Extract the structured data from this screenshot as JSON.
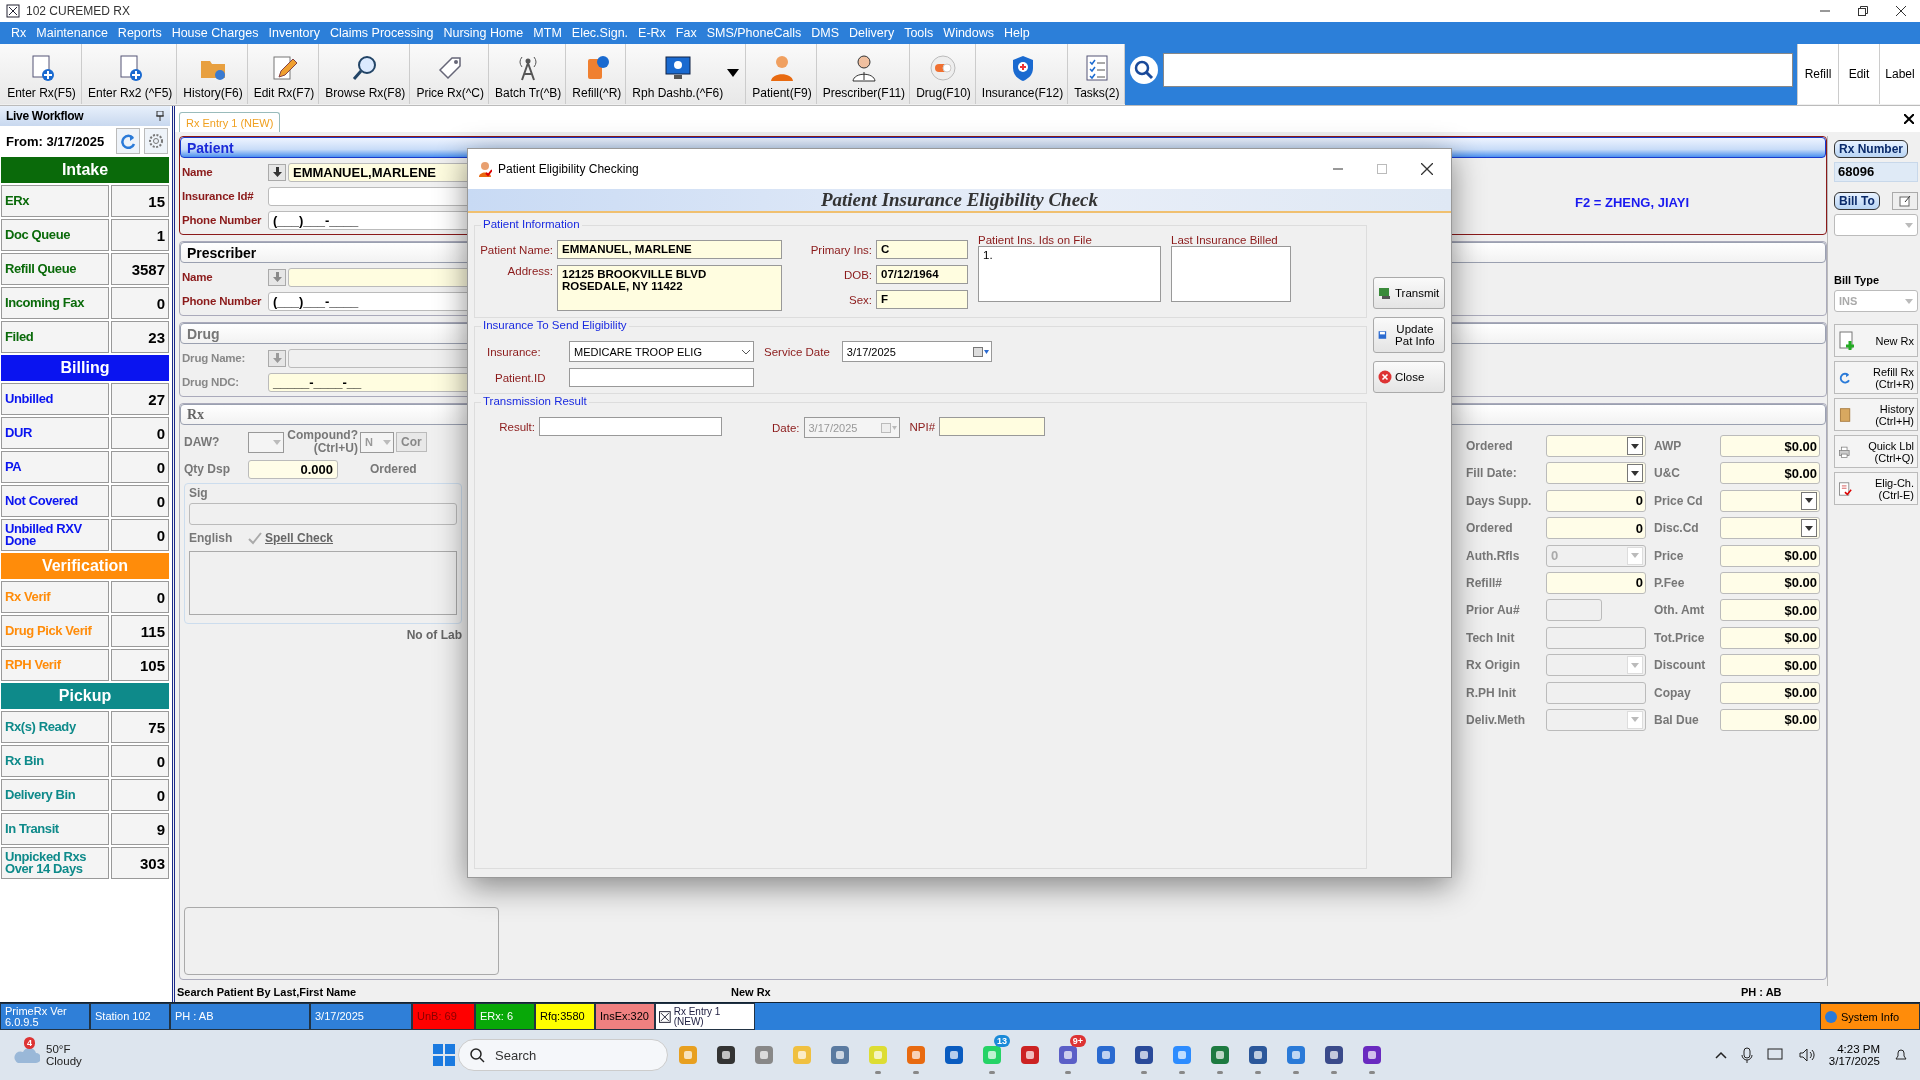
{
  "window": {
    "title": "102 CUREMED RX"
  },
  "menu": [
    "Rx",
    "Maintenance",
    "Reports",
    "House Charges",
    "Inventory",
    "Claims Processing",
    "Nursing Home",
    "MTM",
    "Elec.Sign.",
    "E-Rx",
    "Fax",
    "SMS/PhoneCalls",
    "DMS",
    "Delivery",
    "Tools",
    "Windows",
    "Help"
  ],
  "toolbar": [
    {
      "label": "Enter Rx(F5)",
      "has_menu": false
    },
    {
      "label": "Enter Rx2 (^F5)",
      "has_menu": false
    },
    {
      "label": "History(F6)",
      "has_menu": false
    },
    {
      "label": "Edit Rx(F7)",
      "has_menu": false
    },
    {
      "label": "Browse Rx(F8)",
      "has_menu": false
    },
    {
      "label": "Price Rx(^C)",
      "has_menu": false
    },
    {
      "label": "Batch Tr(^B)",
      "has_menu": false
    },
    {
      "label": "Refill(^R)",
      "has_menu": false
    },
    {
      "label": "Rph Dashb.(^F6)",
      "has_menu": true
    },
    {
      "label": "Patient(F9)",
      "has_menu": false
    },
    {
      "label": "Prescriber(F11)",
      "has_menu": false
    },
    {
      "label": "Drug(F10)",
      "has_menu": false
    },
    {
      "label": "Insurance(F12)",
      "has_menu": false
    },
    {
      "label": "Tasks(2)",
      "has_menu": false
    }
  ],
  "toolbar_right": [
    "Refill",
    "Edit",
    "Label"
  ],
  "sidebar": {
    "title": "Live Workflow",
    "from": "From: 3/17/2025",
    "groups": [
      {
        "title": "Intake",
        "color": "#0a6a0a",
        "items": [
          {
            "label": "ERx",
            "count": "15"
          },
          {
            "label": "Doc Queue",
            "count": "1"
          },
          {
            "label": "Refill Queue",
            "count": "3587"
          },
          {
            "label": "Incoming Fax",
            "count": "0"
          },
          {
            "label": "Filed",
            "count": "23"
          }
        ]
      },
      {
        "title": "Billing",
        "color": "#0a14f0",
        "items": [
          {
            "label": "Unbilled",
            "count": "27"
          },
          {
            "label": "DUR",
            "count": "0"
          },
          {
            "label": "PA",
            "count": "0"
          },
          {
            "label": "Not Covered",
            "count": "0"
          },
          {
            "label": "Unbilled RXV Done",
            "count": "0"
          }
        ]
      },
      {
        "title": "Verification",
        "color": "#ff8c0a",
        "items": [
          {
            "label": "Rx Verif",
            "count": "0"
          },
          {
            "label": "Drug Pick Verif",
            "count": "115"
          },
          {
            "label": "RPH Verif",
            "count": "105"
          }
        ]
      },
      {
        "title": "Pickup",
        "color": "#0e8a8a",
        "items": [
          {
            "label": "Rx(s) Ready",
            "count": "75"
          },
          {
            "label": "Rx Bin",
            "count": "0"
          },
          {
            "label": "Delivery Bin",
            "count": "0"
          },
          {
            "label": "In Transit",
            "count": "9"
          },
          {
            "label": "Unpicked Rxs Over 14 Days",
            "count": "303"
          }
        ]
      }
    ]
  },
  "tabs": [
    {
      "label": "Rx Entry 1 (NEW)",
      "selected": true
    }
  ],
  "patient": {
    "title": "Patient",
    "name_label": "Name",
    "name": "EMMANUEL,MARLENE",
    "insurance_label": "Insurance Id#",
    "phone_label": "Phone Number",
    "phone": "(___)___-____",
    "note": "F2 = ZHENG, JIAYI"
  },
  "prescriber": {
    "title": "Prescriber",
    "name_label": "Name",
    "phone_label": "Phone Number",
    "phone": "(___)___-____"
  },
  "drug": {
    "title": "Drug",
    "name_label": "Drug Name:",
    "ndc_label": "Drug NDC:",
    "ndc": "_____-____-__"
  },
  "rx": {
    "title": "Rx",
    "daw_label": "DAW?",
    "compound_label": "Compound? (Ctrl+U)",
    "compound": "N",
    "compound_button": "Cor",
    "qty_label": "Qty Dsp",
    "qty": "0.000",
    "ordered_label": "Ordered",
    "sig_label": "Sig",
    "language": "English",
    "spell_check": "Spell Check",
    "labels_note": "No of Lab"
  },
  "billing": {
    "left": [
      {
        "label": "Ordered",
        "kind": "dropdown",
        "disabled": false
      },
      {
        "label": "Fill Date:",
        "kind": "dropdown",
        "disabled": false
      },
      {
        "label": "Days Supp.",
        "kind": "input",
        "value": "0",
        "disabled": false
      },
      {
        "label": "Ordered",
        "kind": "input",
        "value": "0",
        "disabled": false
      },
      {
        "label": "Auth.Rfls",
        "kind": "dropdown",
        "value": "0",
        "disabled": true
      },
      {
        "label": "Refill#",
        "kind": "input",
        "value": "0",
        "disabled": false
      },
      {
        "label": "Prior Au#",
        "kind": "short",
        "disabled": true
      },
      {
        "label": "Tech Init",
        "kind": "input",
        "disabled": true
      },
      {
        "label": "Rx Origin",
        "kind": "dropdown",
        "disabled": true
      },
      {
        "label": "R.PH Init",
        "kind": "input",
        "disabled": true
      },
      {
        "label": "Deliv.Meth",
        "kind": "dropdown",
        "disabled": true
      }
    ],
    "right": [
      {
        "label": "AWP",
        "kind": "input",
        "value": "$0.00"
      },
      {
        "label": "U&C",
        "kind": "input",
        "value": "$0.00"
      },
      {
        "label": "Price Cd",
        "kind": "dropdown"
      },
      {
        "label": "Disc.Cd",
        "kind": "dropdown"
      },
      {
        "label": "Price",
        "kind": "input",
        "value": "$0.00"
      },
      {
        "label": "P.Fee",
        "kind": "input",
        "value": "$0.00"
      },
      {
        "label": "Oth. Amt",
        "kind": "input",
        "value": "$0.00"
      },
      {
        "label": "Tot.Price",
        "kind": "input",
        "value": "$0.00"
      },
      {
        "label": "Discount",
        "kind": "input",
        "value": "$0.00"
      },
      {
        "label": "Copay",
        "kind": "input",
        "value": "$0.00"
      },
      {
        "label": "Bal Due",
        "kind": "input",
        "value": "$0.00"
      }
    ]
  },
  "side_panel": {
    "rx_number_label": "Rx Number",
    "rx_number": "68096",
    "bill_to_label": "Bill To",
    "bill_type_label": "Bill Type",
    "bill_type": "INS",
    "actions": [
      "New Rx",
      "Refill Rx (Ctrl+R)",
      "History (Ctrl+H)",
      "Quick Lbl (Ctrl+Q)",
      "Elig-Ch. (Ctrl-E)"
    ]
  },
  "dialog": {
    "title": "Patient Eligibility Checking",
    "heading": "Patient Insurance Eligibility Check",
    "patient_info": {
      "legend": "Patient Information",
      "name_label": "Patient Name:",
      "name": "EMMANUEL, MARLENE",
      "address_label": "Address:",
      "address": [
        "12125 BROOKVILLE BLVD",
        "ROSEDALE, NY 11422"
      ],
      "primary_ins_label": "Primary Ins:",
      "primary_ins": "C",
      "dob_label": "DOB:",
      "dob": "07/12/1964",
      "sex_label": "Sex:",
      "sex": "F",
      "ids_label": "Patient Ins. Ids on File",
      "ids": "1.",
      "last_label": "Last Insurance Billed"
    },
    "insurance": {
      "legend": "Insurance To Send Eligibility",
      "insurance_label": "Insurance:",
      "insurance": "MEDICARE TROOP ELIG",
      "service_date_label": "Service Date",
      "service_date": "3/17/2025",
      "patient_id_label": "Patient.ID"
    },
    "result": {
      "legend": "Transmission Result",
      "result_label": "Result:",
      "date_label": "Date:",
      "date": "3/17/2025",
      "npi_label": "NPI#"
    },
    "buttons": [
      "Transmit",
      "Update Pat Info",
      "Close"
    ]
  },
  "status_row": [
    "Search Patient By Last,First Name",
    "New Rx",
    "PH : AB"
  ],
  "status_bar": [
    {
      "label": "PrimeRx Ver 6.0.9.5",
      "color": "#2f7fd8"
    },
    {
      "label": "Station 102",
      "color": "#2f7fd8"
    },
    {
      "label": "PH : AB",
      "color": "#2f7fd8"
    },
    {
      "label": "3/17/2025",
      "color": "#2f7fd8"
    },
    {
      "label": "UnB: 69",
      "color": "#ff0000"
    },
    {
      "label": "ERx: 6",
      "color": "#08a808"
    },
    {
      "label": "Rfq:3580",
      "color": "#ffff00"
    },
    {
      "label": "InsEx:320",
      "color": "#f08080"
    }
  ],
  "status_tab": "Rx Entry 1 (NEW)",
  "system_info": "System Info",
  "taskbar": {
    "weather_badge": "4",
    "temperature": "50°F",
    "condition": "Cloudy",
    "search_placeholder": "Search",
    "apps": [
      {
        "running": false
      },
      {
        "running": false
      },
      {
        "running": false
      },
      {
        "running": false
      },
      {
        "running": false
      },
      {
        "running": true
      },
      {
        "running": true
      },
      {
        "running": false
      },
      {
        "running": true,
        "badge": "13"
      },
      {
        "running": false
      },
      {
        "running": true,
        "badge": "9+"
      },
      {
        "running": false
      },
      {
        "running": true
      },
      {
        "running": true
      },
      {
        "running": true
      },
      {
        "running": true
      },
      {
        "running": true
      },
      {
        "running": true
      },
      {
        "running": true
      }
    ],
    "time": "4:23 PM",
    "date": "3/17/2025"
  }
}
